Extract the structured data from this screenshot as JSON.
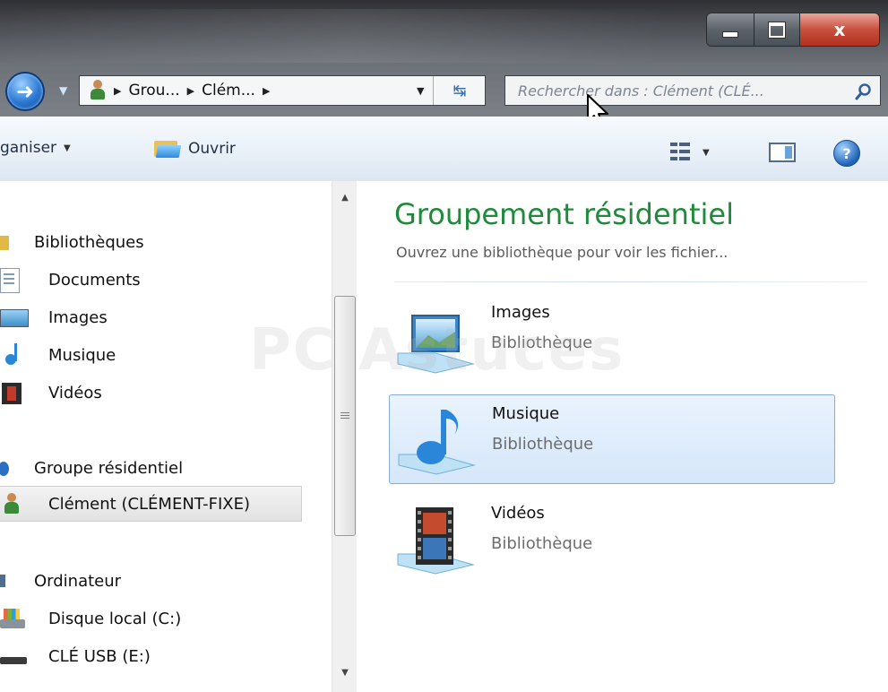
{
  "window": {
    "caption_buttons": {
      "minimize": "",
      "maximize": "",
      "close": "x"
    }
  },
  "address": {
    "crumbs": [
      "Grou...",
      "Clém..."
    ],
    "search_placeholder": "Rechercher dans : Clément (CLÉ..."
  },
  "toolbar": {
    "organize_label": "ganiser",
    "open_label": "Ouvrir",
    "help_label": "?"
  },
  "nav": {
    "libraries_label": "Bibliothèques",
    "libraries": [
      "Documents",
      "Images",
      "Musique",
      "Vidéos"
    ],
    "homegroup_label": "Groupe résidentiel",
    "homegroup_member": "Clément (CLÉMENT-FIXE)",
    "computer_label": "Ordinateur",
    "drives": [
      "Disque local (C:)",
      "CLÉ USB (E:)"
    ]
  },
  "content": {
    "title": "Groupement résidentiel",
    "subtitle": "Ouvrez une bibliothèque pour voir les fichier...",
    "items": [
      {
        "name": "Images",
        "type": "Bibliothèque"
      },
      {
        "name": "Musique",
        "type": "Bibliothèque"
      },
      {
        "name": "Vidéos",
        "type": "Bibliothèque"
      }
    ],
    "selected_item": "Musique"
  },
  "watermark": "PC Astuces",
  "colors": {
    "title_green": "#1f8a3a",
    "selection_fill": "#d5e7fa",
    "selection_border": "#84acdd",
    "toolbar_text": "#1f2f47"
  }
}
